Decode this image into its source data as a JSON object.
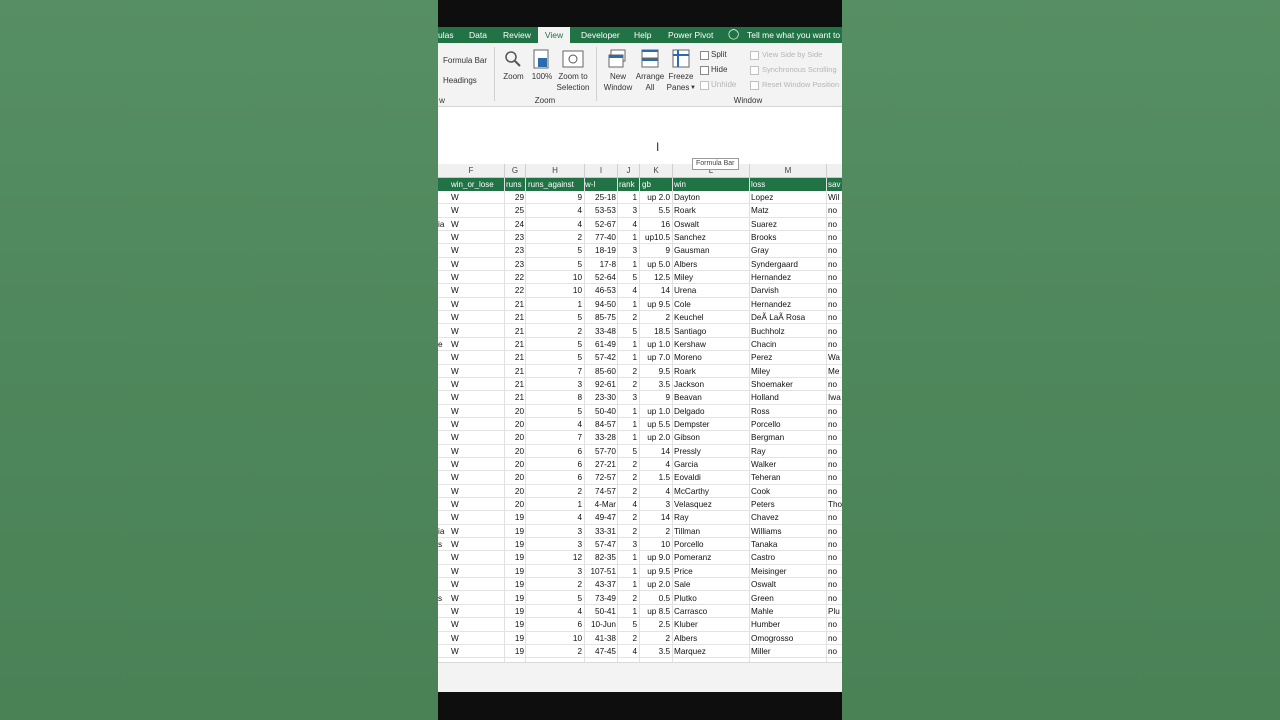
{
  "tabs": [
    {
      "label": "ulas",
      "active": false
    },
    {
      "label": "Data",
      "active": false
    },
    {
      "label": "Review",
      "active": false
    },
    {
      "label": "View",
      "active": true
    },
    {
      "label": "Developer",
      "active": false
    },
    {
      "label": "Help",
      "active": false
    },
    {
      "label": "Power Pivot",
      "active": false
    }
  ],
  "tell_me": "Tell me what you want to d",
  "ribbon": {
    "show": {
      "formula_bar": "Formula Bar",
      "headings": "Headings",
      "group_label": "w"
    },
    "zoom": {
      "zoom": "Zoom",
      "hundred": "100%",
      "zoom_to_selection_1": "Zoom to",
      "zoom_to_selection_2": "Selection",
      "group_label": "Zoom"
    },
    "window": {
      "new_window_1": "New",
      "new_window_2": "Window",
      "arrange_all_1": "Arrange",
      "arrange_all_2": "All",
      "freeze_panes_1": "Freeze",
      "freeze_panes_2": "Panes",
      "split": "Split",
      "hide": "Hide",
      "unhide": "Unhide",
      "view_side": "View Side by Side",
      "sync_scroll": "Synchronous Scrolling",
      "reset_pos": "Reset Window Position",
      "group_label": "Window"
    }
  },
  "tooltip": "Formula Bar",
  "column_letters": [
    "F",
    "G",
    "H",
    "I",
    "J",
    "K",
    "L",
    "M"
  ],
  "headers": [
    "win_or_lose",
    "runs",
    "runs_against",
    "w-l",
    "rank",
    "gb",
    "win",
    "loss",
    "sav"
  ],
  "rows": [
    {
      "pre": "",
      "wl": "W",
      "runs": "29",
      "ra": "9",
      "w_l": "25-18",
      "rank": "1",
      "gb": "up 2.0",
      "win": "Dayton",
      "loss": "Lopez",
      "save": "Wil"
    },
    {
      "pre": "",
      "wl": "W",
      "runs": "25",
      "ra": "4",
      "w_l": "53-53",
      "rank": "3",
      "gb": "5.5",
      "win": "Roark",
      "loss": "Matz",
      "save": "no"
    },
    {
      "pre": "ia",
      "wl": "W",
      "runs": "24",
      "ra": "4",
      "w_l": "52-67",
      "rank": "4",
      "gb": "16",
      "win": "Oswalt",
      "loss": "Suarez",
      "save": "no"
    },
    {
      "pre": "",
      "wl": "W",
      "runs": "23",
      "ra": "2",
      "w_l": "77-40",
      "rank": "1",
      "gb": "up10.5",
      "win": "Sanchez",
      "loss": "Brooks",
      "save": "no"
    },
    {
      "pre": "",
      "wl": "W",
      "runs": "23",
      "ra": "5",
      "w_l": "18-19",
      "rank": "3",
      "gb": "9",
      "win": "Gausman",
      "loss": "Gray",
      "save": "no"
    },
    {
      "pre": "",
      "wl": "W",
      "runs": "23",
      "ra": "5",
      "w_l": "17-8",
      "rank": "1",
      "gb": "up 5.0",
      "win": "Albers",
      "loss": "Syndergaard",
      "save": "no"
    },
    {
      "pre": "",
      "wl": "W",
      "runs": "22",
      "ra": "10",
      "w_l": "52-64",
      "rank": "5",
      "gb": "12.5",
      "win": "Miley",
      "loss": "Hernandez",
      "save": "no"
    },
    {
      "pre": "",
      "wl": "W",
      "runs": "22",
      "ra": "10",
      "w_l": "46-53",
      "rank": "4",
      "gb": "14",
      "win": "Urena",
      "loss": "Darvish",
      "save": "no"
    },
    {
      "pre": "",
      "wl": "W",
      "runs": "21",
      "ra": "1",
      "w_l": "94-50",
      "rank": "1",
      "gb": "up 9.5",
      "win": "Cole",
      "loss": "Hernandez",
      "save": "no"
    },
    {
      "pre": "",
      "wl": "W",
      "runs": "21",
      "ra": "5",
      "w_l": "85-75",
      "rank": "2",
      "gb": "2",
      "win": "Keuchel",
      "loss": "DeÃ LaÃ Rosa",
      "save": "no"
    },
    {
      "pre": "",
      "wl": "W",
      "runs": "21",
      "ra": "2",
      "w_l": "33-48",
      "rank": "5",
      "gb": "18.5",
      "win": "Santiago",
      "loss": "Buchholz",
      "save": "no"
    },
    {
      "pre": "e",
      "wl": "W",
      "runs": "21",
      "ra": "5",
      "w_l": "61-49",
      "rank": "1",
      "gb": "up 1.0",
      "win": "Kershaw",
      "loss": "Chacin",
      "save": "no"
    },
    {
      "pre": "",
      "wl": "W",
      "runs": "21",
      "ra": "5",
      "w_l": "57-42",
      "rank": "1",
      "gb": "up 7.0",
      "win": "Moreno",
      "loss": "Perez",
      "save": "Wa"
    },
    {
      "pre": "",
      "wl": "W",
      "runs": "21",
      "ra": "7",
      "w_l": "85-60",
      "rank": "2",
      "gb": "9.5",
      "win": "Roark",
      "loss": "Miley",
      "save": "Me"
    },
    {
      "pre": "",
      "wl": "W",
      "runs": "21",
      "ra": "3",
      "w_l": "92-61",
      "rank": "2",
      "gb": "3.5",
      "win": "Jackson",
      "loss": "Shoemaker",
      "save": "no"
    },
    {
      "pre": "",
      "wl": "W",
      "runs": "21",
      "ra": "8",
      "w_l": "23-30",
      "rank": "3",
      "gb": "9",
      "win": "Beavan",
      "loss": "Holland",
      "save": "Iwa"
    },
    {
      "pre": "",
      "wl": "W",
      "runs": "20",
      "ra": "5",
      "w_l": "50-40",
      "rank": "1",
      "gb": "up 1.0",
      "win": "Delgado",
      "loss": "Ross",
      "save": "no"
    },
    {
      "pre": "",
      "wl": "W",
      "runs": "20",
      "ra": "4",
      "w_l": "84-57",
      "rank": "1",
      "gb": "up 5.5",
      "win": "Dempster",
      "loss": "Porcello",
      "save": "no"
    },
    {
      "pre": "",
      "wl": "W",
      "runs": "20",
      "ra": "7",
      "w_l": "33-28",
      "rank": "1",
      "gb": "up 2.0",
      "win": "Gibson",
      "loss": "Bergman",
      "save": "no"
    },
    {
      "pre": "",
      "wl": "W",
      "runs": "20",
      "ra": "6",
      "w_l": "57-70",
      "rank": "5",
      "gb": "14",
      "win": "Pressly",
      "loss": "Ray",
      "save": "no"
    },
    {
      "pre": "",
      "wl": "W",
      "runs": "20",
      "ra": "6",
      "w_l": "27-21",
      "rank": "2",
      "gb": "4",
      "win": "Garcia",
      "loss": "Walker",
      "save": "no"
    },
    {
      "pre": "",
      "wl": "W",
      "runs": "20",
      "ra": "6",
      "w_l": "72-57",
      "rank": "2",
      "gb": "1.5",
      "win": "Eovaldi",
      "loss": "Teheran",
      "save": "no"
    },
    {
      "pre": "",
      "wl": "W",
      "runs": "20",
      "ra": "2",
      "w_l": "74-57",
      "rank": "2",
      "gb": "4",
      "win": "McCarthy",
      "loss": "Cook",
      "save": "no"
    },
    {
      "pre": "",
      "wl": "W",
      "runs": "20",
      "ra": "1",
      "w_l": "4-Mar",
      "rank": "4",
      "gb": "3",
      "win": "Velasquez",
      "loss": "Peters",
      "save": "Tho"
    },
    {
      "pre": "",
      "wl": "W",
      "runs": "19",
      "ra": "4",
      "w_l": "49-47",
      "rank": "2",
      "gb": "14",
      "win": "Ray",
      "loss": "Chavez",
      "save": "no"
    },
    {
      "pre": "ia",
      "wl": "W",
      "runs": "19",
      "ra": "3",
      "w_l": "33-31",
      "rank": "2",
      "gb": "2",
      "win": "Tillman",
      "loss": "Williams",
      "save": "no"
    },
    {
      "pre": "s",
      "wl": "W",
      "runs": "19",
      "ra": "3",
      "w_l": "57-47",
      "rank": "3",
      "gb": "10",
      "win": "Porcello",
      "loss": "Tanaka",
      "save": "no"
    },
    {
      "pre": "",
      "wl": "W",
      "runs": "19",
      "ra": "12",
      "w_l": "82-35",
      "rank": "1",
      "gb": "up 9.0",
      "win": "Pomeranz",
      "loss": "Castro",
      "save": "no"
    },
    {
      "pre": "",
      "wl": "W",
      "runs": "19",
      "ra": "3",
      "w_l": "107-51",
      "rank": "1",
      "gb": "up 9.5",
      "win": "Price",
      "loss": "Meisinger",
      "save": "no"
    },
    {
      "pre": "",
      "wl": "W",
      "runs": "19",
      "ra": "2",
      "w_l": "43-37",
      "rank": "1",
      "gb": "up 2.0",
      "win": "Sale",
      "loss": "Oswalt",
      "save": "no"
    },
    {
      "pre": "s",
      "wl": "W",
      "runs": "19",
      "ra": "5",
      "w_l": "73-49",
      "rank": "2",
      "gb": "0.5",
      "win": "Plutko",
      "loss": "Green",
      "save": "no"
    },
    {
      "pre": "",
      "wl": "W",
      "runs": "19",
      "ra": "4",
      "w_l": "50-41",
      "rank": "1",
      "gb": "up 8.5",
      "win": "Carrasco",
      "loss": "Mahle",
      "save": "Plu"
    },
    {
      "pre": "",
      "wl": "W",
      "runs": "19",
      "ra": "6",
      "w_l": "10-Jun",
      "rank": "5",
      "gb": "2.5",
      "win": "Kluber",
      "loss": "Humber",
      "save": "no"
    },
    {
      "pre": "",
      "wl": "W",
      "runs": "19",
      "ra": "10",
      "w_l": "41-38",
      "rank": "2",
      "gb": "2",
      "win": "Albers",
      "loss": "Omogrosso",
      "save": "no"
    },
    {
      "pre": "",
      "wl": "W",
      "runs": "19",
      "ra": "2",
      "w_l": "47-45",
      "rank": "4",
      "gb": "3.5",
      "win": "Marquez",
      "loss": "Miller",
      "save": "no"
    }
  ]
}
